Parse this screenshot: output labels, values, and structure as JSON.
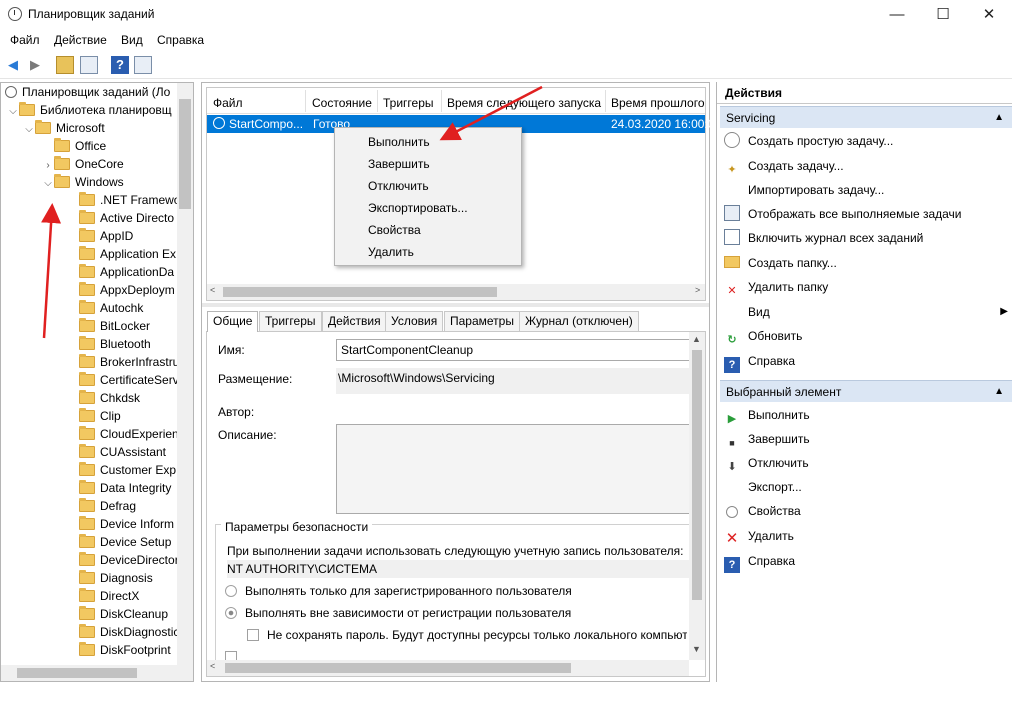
{
  "window": {
    "title": "Планировщик заданий",
    "minimize": "—",
    "maximize": "☐",
    "close": "✕"
  },
  "menu": {
    "file": "Файл",
    "action": "Действие",
    "view": "Вид",
    "help": "Справка"
  },
  "tree": {
    "root": "Планировщик заданий (Ло",
    "library": "Библиотека планировщ",
    "microsoft": "Microsoft",
    "office": "Office",
    "onecore": "OneCore",
    "windows": "Windows",
    "items": [
      ".NET Framewo",
      "Active Directo",
      "AppID",
      "Application Ex",
      "ApplicationDa",
      "AppxDeploym",
      "Autochk",
      "BitLocker",
      "Bluetooth",
      "BrokerInfrastru",
      "CertificateServ",
      "Chkdsk",
      "Clip",
      "CloudExperien",
      "CUAssistant",
      "Customer Exp",
      "Data Integrity",
      "Defrag",
      "Device Inform",
      "Device Setup",
      "DeviceDirector",
      "Diagnosis",
      "DirectX",
      "DiskCleanup",
      "DiskDiagnostic",
      "DiskFootprint"
    ]
  },
  "tasklist": {
    "columns": [
      "Файл",
      "Состояние",
      "Триггеры",
      "Время следующего запуска",
      "Время прошлого"
    ],
    "row": {
      "name": "StartCompo...",
      "status": "Готово",
      "last_run": "24.03.2020 16:00:0"
    }
  },
  "context_menu": [
    "Выполнить",
    "Завершить",
    "Отключить",
    "Экспортировать...",
    "Свойства",
    "Удалить"
  ],
  "details": {
    "tabs": [
      "Общие",
      "Триггеры",
      "Действия",
      "Условия",
      "Параметры",
      "Журнал (отключен)"
    ],
    "name_label": "Имя:",
    "name_value": "StartComponentCleanup",
    "location_label": "Размещение:",
    "location_value": "\\Microsoft\\Windows\\Servicing",
    "author_label": "Автор:",
    "description_label": "Описание:",
    "security_title": "Параметры безопасности",
    "account_text": "При выполнении задачи использовать следующую учетную запись пользователя:",
    "account_value": "NT AUTHORITY\\СИСТЕМА",
    "radio1": "Выполнять только для зарегистрированного пользователя",
    "radio2": "Выполнять вне зависимости от регистрации пользователя",
    "checkbox1": "Не сохранять пароль. Будут доступны ресурсы только локального компьют"
  },
  "actions": {
    "header": "Действия",
    "section1": "Servicing",
    "items1": [
      "Создать простую задачу...",
      "Создать задачу...",
      "Импортировать задачу...",
      "Отображать все выполняемые задачи",
      "Включить журнал всех заданий",
      "Создать папку...",
      "Удалить папку",
      "Вид",
      "Обновить",
      "Справка"
    ],
    "section2": "Выбранный элемент",
    "items2": [
      "Выполнить",
      "Завершить",
      "Отключить",
      "Экспорт...",
      "Свойства",
      "Удалить",
      "Справка"
    ]
  },
  "colors": {
    "selection": "#0078d7",
    "section_bg": "#dbe6f4",
    "arrow": "#e02020"
  }
}
